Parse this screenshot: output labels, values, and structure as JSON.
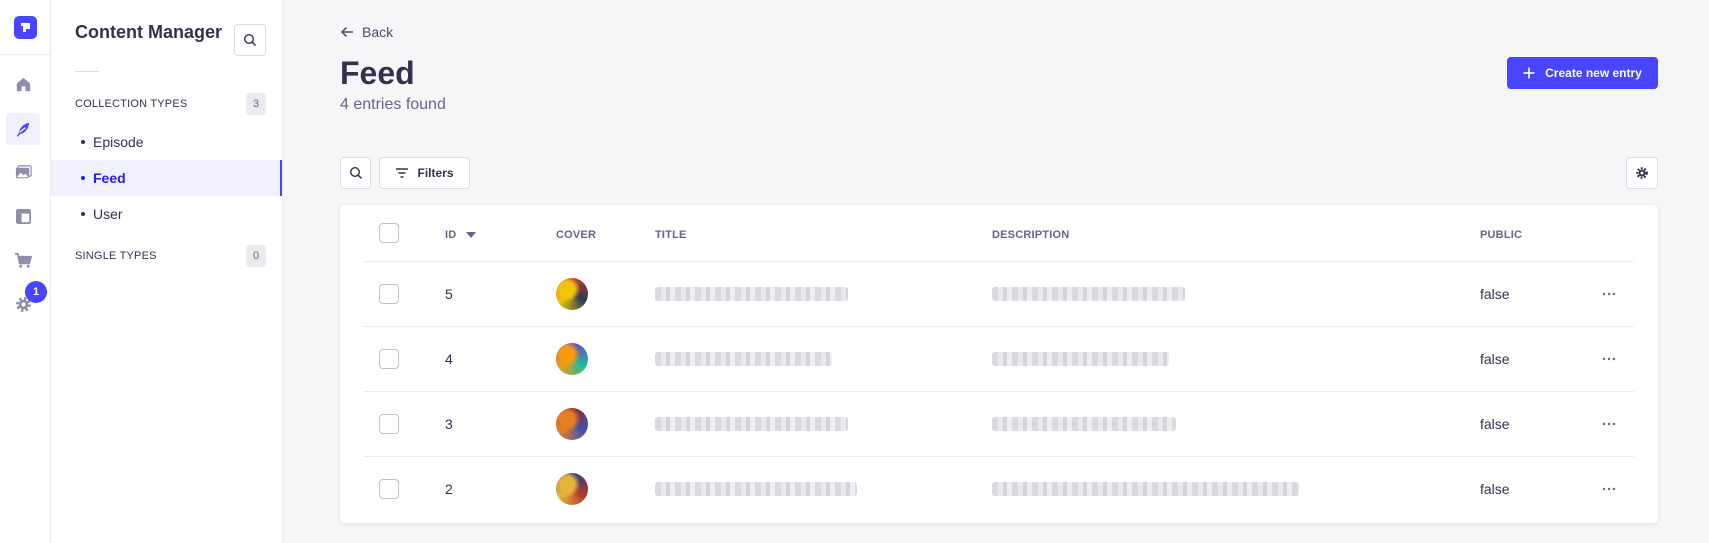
{
  "rail": {
    "badge_count": "1",
    "icons": [
      "strapi-logo-icon",
      "home-icon",
      "content-manager-feather-icon",
      "media-library-icon",
      "content-type-builder-icon",
      "marketplace-cart-icon",
      "settings-gear-icon"
    ]
  },
  "subnav": {
    "title": "Content Manager",
    "collection_types_label": "COLLECTION TYPES",
    "collection_types_count": "3",
    "items": [
      {
        "label": "Episode",
        "active": false
      },
      {
        "label": "Feed",
        "active": true
      },
      {
        "label": "User",
        "active": false
      }
    ],
    "single_types_label": "SINGLE TYPES",
    "single_types_count": "0"
  },
  "header": {
    "back_label": "Back",
    "title": "Feed",
    "subtitle": "4 entries found",
    "create_label": "Create new entry"
  },
  "toolbar": {
    "filters_label": "Filters"
  },
  "table": {
    "columns": [
      "ID",
      "COVER",
      "TITLE",
      "DESCRIPTION",
      "PUBLIC"
    ],
    "sort_column": "ID",
    "sort_direction": "descending",
    "rows": [
      {
        "id": "5",
        "public": "false",
        "cover_colors": [
          "#c0392b",
          "#f1c40f",
          "#2c3e50"
        ]
      },
      {
        "id": "4",
        "public": "false",
        "cover_colors": [
          "#6c3fd0",
          "#f39c12",
          "#1abc9c"
        ]
      },
      {
        "id": "3",
        "public": "false",
        "cover_colors": [
          "#8e2b2b",
          "#e67e22",
          "#3f51b5"
        ]
      },
      {
        "id": "2",
        "public": "false",
        "cover_colors": [
          "#2d3a8c",
          "#e8b33b",
          "#b03a2e"
        ]
      }
    ]
  },
  "colors": {
    "primary": "#4945ff",
    "primary_dark": "#271fe0",
    "background": "#f6f6f9",
    "text": "#32324d",
    "muted": "#666687"
  }
}
